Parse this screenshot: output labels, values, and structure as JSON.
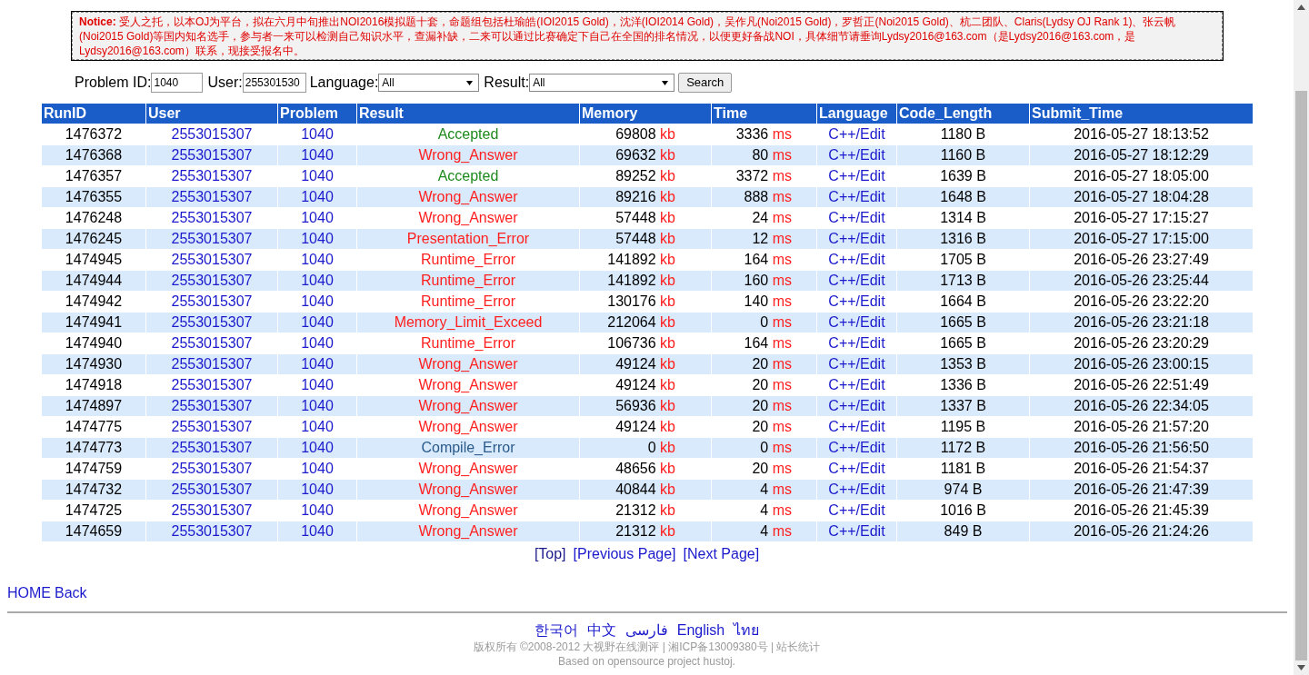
{
  "notice": "**Notice:** 受人之托，以本OJ为平台，拟在六月中旬推出NOI2016模拟题十套，命题组包括杜瑜皓(IOI2015 Gold)，沈洋(IOI2014 Gold)，吴作凡(Noi2015 Gold)，罗哲正(Noi2015 Gold)、杭二团队、Claris(Lydsy OJ Rank 1)、张云帆(Noi2015 Gold)等国内知名选手，参与者一来可以检测自己知识水平，查漏补缺，二来可以通过比赛确定下自己在全国的排名情况，以便更好备战NOI，具体细节请垂询Lydsy2016@163.com（是Lydsy2016@163.com，是Lydsy2016@163.com）联系，现接受报名中。",
  "filter": {
    "problem_label": "Problem ID:",
    "problem_value": "1040",
    "user_label": "User:",
    "user_value": "255301530",
    "language_label": "Language:",
    "language_value": "All",
    "result_label": "Result:",
    "result_value": "All",
    "search_button": "Search"
  },
  "table": {
    "columns": [
      "RunID",
      "User",
      "Problem",
      "Result",
      "Memory",
      "Time",
      "Language",
      "Code_Length",
      "Submit_Time"
    ],
    "rows": [
      {
        "run_id": "1476372",
        "user": "2553015307",
        "problem": "1040",
        "result": "Accepted",
        "kind": "accepted",
        "memory": "69808",
        "memory_unit": "kb",
        "time": "3336",
        "time_unit": "ms",
        "language": "C++/Edit",
        "code_length": "1180 B",
        "submit_time": "2016-05-27 18:13:52"
      },
      {
        "run_id": "1476368",
        "user": "2553015307",
        "problem": "1040",
        "result": "Wrong_Answer",
        "kind": "error",
        "memory": "69632",
        "memory_unit": "kb",
        "time": "80",
        "time_unit": "ms",
        "language": "C++/Edit",
        "code_length": "1160 B",
        "submit_time": "2016-05-27 18:12:29"
      },
      {
        "run_id": "1476357",
        "user": "2553015307",
        "problem": "1040",
        "result": "Accepted",
        "kind": "accepted",
        "memory": "89252",
        "memory_unit": "kb",
        "time": "3372",
        "time_unit": "ms",
        "language": "C++/Edit",
        "code_length": "1639 B",
        "submit_time": "2016-05-27 18:05:00"
      },
      {
        "run_id": "1476355",
        "user": "2553015307",
        "problem": "1040",
        "result": "Wrong_Answer",
        "kind": "error",
        "memory": "89216",
        "memory_unit": "kb",
        "time": "888",
        "time_unit": "ms",
        "language": "C++/Edit",
        "code_length": "1648 B",
        "submit_time": "2016-05-27 18:04:28"
      },
      {
        "run_id": "1476248",
        "user": "2553015307",
        "problem": "1040",
        "result": "Wrong_Answer",
        "kind": "error",
        "memory": "57448",
        "memory_unit": "kb",
        "time": "24",
        "time_unit": "ms",
        "language": "C++/Edit",
        "code_length": "1314 B",
        "submit_time": "2016-05-27 17:15:27"
      },
      {
        "run_id": "1476245",
        "user": "2553015307",
        "problem": "1040",
        "result": "Presentation_Error",
        "kind": "error",
        "memory": "57448",
        "memory_unit": "kb",
        "time": "12",
        "time_unit": "ms",
        "language": "C++/Edit",
        "code_length": "1316 B",
        "submit_time": "2016-05-27 17:15:00"
      },
      {
        "run_id": "1474945",
        "user": "2553015307",
        "problem": "1040",
        "result": "Runtime_Error",
        "kind": "error",
        "memory": "141892",
        "memory_unit": "kb",
        "time": "164",
        "time_unit": "ms",
        "language": "C++/Edit",
        "code_length": "1705 B",
        "submit_time": "2016-05-26 23:27:49"
      },
      {
        "run_id": "1474944",
        "user": "2553015307",
        "problem": "1040",
        "result": "Runtime_Error",
        "kind": "error",
        "memory": "141892",
        "memory_unit": "kb",
        "time": "160",
        "time_unit": "ms",
        "language": "C++/Edit",
        "code_length": "1713 B",
        "submit_time": "2016-05-26 23:25:44"
      },
      {
        "run_id": "1474942",
        "user": "2553015307",
        "problem": "1040",
        "result": "Runtime_Error",
        "kind": "error",
        "memory": "130176",
        "memory_unit": "kb",
        "time": "140",
        "time_unit": "ms",
        "language": "C++/Edit",
        "code_length": "1664 B",
        "submit_time": "2016-05-26 23:22:20"
      },
      {
        "run_id": "1474941",
        "user": "2553015307",
        "problem": "1040",
        "result": "Memory_Limit_Exceed",
        "kind": "error",
        "memory": "212064",
        "memory_unit": "kb",
        "time": "0",
        "time_unit": "ms",
        "language": "C++/Edit",
        "code_length": "1665 B",
        "submit_time": "2016-05-26 23:21:18"
      },
      {
        "run_id": "1474940",
        "user": "2553015307",
        "problem": "1040",
        "result": "Runtime_Error",
        "kind": "error",
        "memory": "106736",
        "memory_unit": "kb",
        "time": "164",
        "time_unit": "ms",
        "language": "C++/Edit",
        "code_length": "1665 B",
        "submit_time": "2016-05-26 23:20:29"
      },
      {
        "run_id": "1474930",
        "user": "2553015307",
        "problem": "1040",
        "result": "Wrong_Answer",
        "kind": "error",
        "memory": "49124",
        "memory_unit": "kb",
        "time": "20",
        "time_unit": "ms",
        "language": "C++/Edit",
        "code_length": "1353 B",
        "submit_time": "2016-05-26 23:00:15"
      },
      {
        "run_id": "1474918",
        "user": "2553015307",
        "problem": "1040",
        "result": "Wrong_Answer",
        "kind": "error",
        "memory": "49124",
        "memory_unit": "kb",
        "time": "20",
        "time_unit": "ms",
        "language": "C++/Edit",
        "code_length": "1336 B",
        "submit_time": "2016-05-26 22:51:49"
      },
      {
        "run_id": "1474897",
        "user": "2553015307",
        "problem": "1040",
        "result": "Wrong_Answer",
        "kind": "error",
        "memory": "56936",
        "memory_unit": "kb",
        "time": "20",
        "time_unit": "ms",
        "language": "C++/Edit",
        "code_length": "1337 B",
        "submit_time": "2016-05-26 22:34:05"
      },
      {
        "run_id": "1474775",
        "user": "2553015307",
        "problem": "1040",
        "result": "Wrong_Answer",
        "kind": "error",
        "memory": "49124",
        "memory_unit": "kb",
        "time": "20",
        "time_unit": "ms",
        "language": "C++/Edit",
        "code_length": "1195 B",
        "submit_time": "2016-05-26 21:57:20"
      },
      {
        "run_id": "1474773",
        "user": "2553015307",
        "problem": "1040",
        "result": "Compile_Error",
        "kind": "compile",
        "memory": "0",
        "memory_unit": "kb",
        "time": "0",
        "time_unit": "ms",
        "language": "C++/Edit",
        "code_length": "1172 B",
        "submit_time": "2016-05-26 21:56:50"
      },
      {
        "run_id": "1474759",
        "user": "2553015307",
        "problem": "1040",
        "result": "Wrong_Answer",
        "kind": "error",
        "memory": "48656",
        "memory_unit": "kb",
        "time": "20",
        "time_unit": "ms",
        "language": "C++/Edit",
        "code_length": "1181 B",
        "submit_time": "2016-05-26 21:54:37"
      },
      {
        "run_id": "1474732",
        "user": "2553015307",
        "problem": "1040",
        "result": "Wrong_Answer",
        "kind": "error",
        "memory": "40844",
        "memory_unit": "kb",
        "time": "4",
        "time_unit": "ms",
        "language": "C++/Edit",
        "code_length": "974 B",
        "submit_time": "2016-05-26 21:47:39"
      },
      {
        "run_id": "1474725",
        "user": "2553015307",
        "problem": "1040",
        "result": "Wrong_Answer",
        "kind": "error",
        "memory": "21312",
        "memory_unit": "kb",
        "time": "4",
        "time_unit": "ms",
        "language": "C++/Edit",
        "code_length": "1016 B",
        "submit_time": "2016-05-26 21:45:39"
      },
      {
        "run_id": "1474659",
        "user": "2553015307",
        "problem": "1040",
        "result": "Wrong_Answer",
        "kind": "error",
        "memory": "21312",
        "memory_unit": "kb",
        "time": "4",
        "time_unit": "ms",
        "language": "C++/Edit",
        "code_length": "849 B",
        "submit_time": "2016-05-26 21:24:26"
      }
    ]
  },
  "pager": [
    "[Top]",
    "[Previous Page]",
    "[Next Page]"
  ],
  "nav_links": [
    "HOME",
    "Back"
  ],
  "languages": [
    "한국어",
    "中文",
    "فارسی",
    "English",
    "ไทย"
  ],
  "copyright": "版权所有 ©2008-2012 大视野在线测评 | 湘ICP备13009380号 | 站长统计",
  "powered_by": "Based on opensource project hustoj."
}
